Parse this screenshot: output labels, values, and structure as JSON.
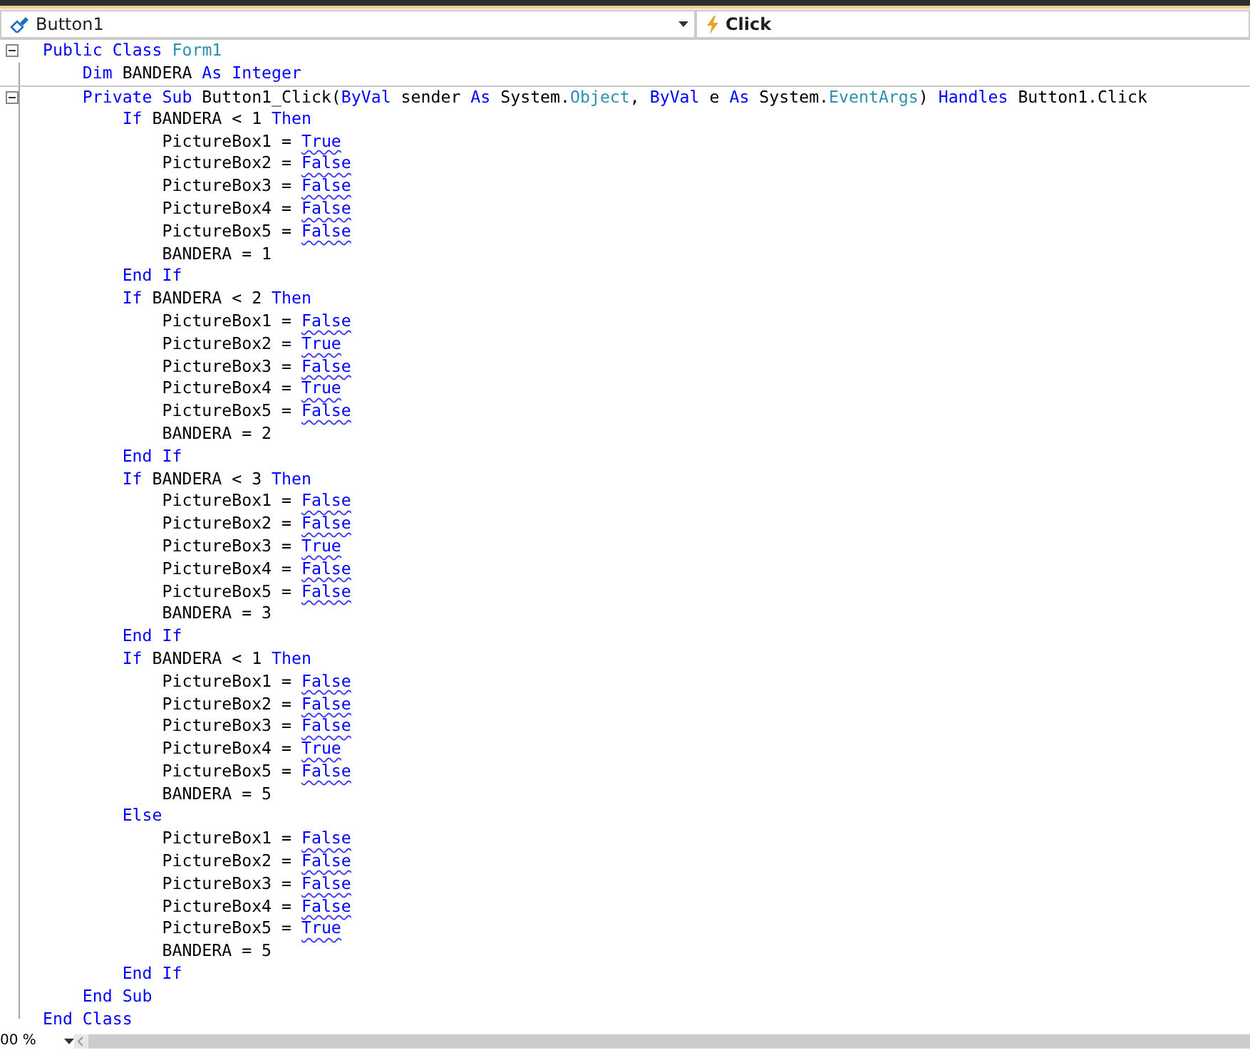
{
  "navigation_bar": {
    "object_dropdown": "Button1",
    "event_dropdown": "Click"
  },
  "code_lines": [
    {
      "expanded": true,
      "tokens": [
        {
          "text": "Public Class ",
          "kind": "kw"
        },
        {
          "text": "Form1",
          "kind": "type"
        }
      ],
      "children": [
        {
          "tokens": [
            {
              "text": "Dim ",
              "kind": "kw"
            },
            {
              "text": "BANDERA ",
              "kind": "plain"
            },
            {
              "text": "As Integer",
              "kind": "kw"
            }
          ]
        },
        {
          "expanded": true,
          "separator_above": true,
          "tokens": [
            {
              "text": "Private Sub ",
              "kind": "kw"
            },
            {
              "text": "Button1_Click(",
              "kind": "plain"
            },
            {
              "text": "ByVal ",
              "kind": "kw"
            },
            {
              "text": "sender ",
              "kind": "plain"
            },
            {
              "text": "As ",
              "kind": "kw"
            },
            {
              "text": "System.",
              "kind": "plain"
            },
            {
              "text": "Object",
              "kind": "type"
            },
            {
              "text": ", ",
              "kind": "plain"
            },
            {
              "text": "ByVal ",
              "kind": "kw"
            },
            {
              "text": "e ",
              "kind": "plain"
            },
            {
              "text": "As ",
              "kind": "kw"
            },
            {
              "text": "System.",
              "kind": "plain"
            },
            {
              "text": "EventArgs",
              "kind": "type"
            },
            {
              "text": ") ",
              "kind": "plain"
            },
            {
              "text": "Handles ",
              "kind": "kw"
            },
            {
              "text": "Button1.Click",
              "kind": "plain"
            }
          ],
          "children": [
            {
              "tokens": [
                {
                  "text": "If ",
                  "kind": "kw"
                },
                {
                  "text": "BANDERA < 1 ",
                  "kind": "plain"
                },
                {
                  "text": "Then",
                  "kind": "kw"
                }
              ],
              "children": [
                {
                  "tokens": [
                    {
                      "text": "PictureBox1 = ",
                      "kind": "plain"
                    },
                    {
                      "text": "True",
                      "kind": "warn"
                    }
                  ]
                },
                {
                  "tokens": [
                    {
                      "text": "PictureBox2 = ",
                      "kind": "plain"
                    },
                    {
                      "text": "False",
                      "kind": "warn"
                    }
                  ]
                },
                {
                  "tokens": [
                    {
                      "text": "PictureBox3 = ",
                      "kind": "plain"
                    },
                    {
                      "text": "False",
                      "kind": "warn"
                    }
                  ]
                },
                {
                  "tokens": [
                    {
                      "text": "PictureBox4 = ",
                      "kind": "plain"
                    },
                    {
                      "text": "False",
                      "kind": "warn"
                    }
                  ]
                },
                {
                  "tokens": [
                    {
                      "text": "PictureBox5 = ",
                      "kind": "plain"
                    },
                    {
                      "text": "False",
                      "kind": "warn"
                    }
                  ]
                },
                {
                  "tokens": [
                    {
                      "text": "BANDERA = 1",
                      "kind": "plain"
                    }
                  ]
                }
              ]
            },
            {
              "tokens": [
                {
                  "text": "End If",
                  "kind": "kw"
                }
              ]
            },
            {
              "tokens": [
                {
                  "text": "If ",
                  "kind": "kw"
                },
                {
                  "text": "BANDERA < 2 ",
                  "kind": "plain"
                },
                {
                  "text": "Then",
                  "kind": "kw"
                }
              ],
              "children": [
                {
                  "tokens": [
                    {
                      "text": "PictureBox1 = ",
                      "kind": "plain"
                    },
                    {
                      "text": "False",
                      "kind": "warn"
                    }
                  ]
                },
                {
                  "tokens": [
                    {
                      "text": "PictureBox2 = ",
                      "kind": "plain"
                    },
                    {
                      "text": "True",
                      "kind": "warn"
                    }
                  ]
                },
                {
                  "tokens": [
                    {
                      "text": "PictureBox3 = ",
                      "kind": "plain"
                    },
                    {
                      "text": "False",
                      "kind": "warn"
                    }
                  ]
                },
                {
                  "tokens": [
                    {
                      "text": "PictureBox4 = ",
                      "kind": "plain"
                    },
                    {
                      "text": "True",
                      "kind": "warn"
                    }
                  ]
                },
                {
                  "tokens": [
                    {
                      "text": "PictureBox5 = ",
                      "kind": "plain"
                    },
                    {
                      "text": "False",
                      "kind": "warn"
                    }
                  ]
                },
                {
                  "tokens": [
                    {
                      "text": "BANDERA = 2",
                      "kind": "plain"
                    }
                  ]
                }
              ]
            },
            {
              "tokens": [
                {
                  "text": "End If",
                  "kind": "kw"
                }
              ]
            },
            {
              "tokens": [
                {
                  "text": "If ",
                  "kind": "kw"
                },
                {
                  "text": "BANDERA < 3 ",
                  "kind": "plain"
                },
                {
                  "text": "Then",
                  "kind": "kw"
                }
              ],
              "children": [
                {
                  "tokens": [
                    {
                      "text": "PictureBox1 = ",
                      "kind": "plain"
                    },
                    {
                      "text": "False",
                      "kind": "warn"
                    }
                  ]
                },
                {
                  "tokens": [
                    {
                      "text": "PictureBox2 = ",
                      "kind": "plain"
                    },
                    {
                      "text": "False",
                      "kind": "warn"
                    }
                  ]
                },
                {
                  "tokens": [
                    {
                      "text": "PictureBox3 = ",
                      "kind": "plain"
                    },
                    {
                      "text": "True",
                      "kind": "warn"
                    }
                  ]
                },
                {
                  "tokens": [
                    {
                      "text": "PictureBox4 = ",
                      "kind": "plain"
                    },
                    {
                      "text": "False",
                      "kind": "warn"
                    }
                  ]
                },
                {
                  "tokens": [
                    {
                      "text": "PictureBox5 = ",
                      "kind": "plain"
                    },
                    {
                      "text": "False",
                      "kind": "warn"
                    }
                  ]
                },
                {
                  "tokens": [
                    {
                      "text": "BANDERA = 3",
                      "kind": "plain"
                    }
                  ]
                }
              ]
            },
            {
              "tokens": [
                {
                  "text": "End If",
                  "kind": "kw"
                }
              ]
            },
            {
              "tokens": [
                {
                  "text": "If ",
                  "kind": "kw"
                },
                {
                  "text": "BANDERA < 1 ",
                  "kind": "plain"
                },
                {
                  "text": "Then",
                  "kind": "kw"
                }
              ],
              "children": [
                {
                  "tokens": [
                    {
                      "text": "PictureBox1 = ",
                      "kind": "plain"
                    },
                    {
                      "text": "False",
                      "kind": "warn"
                    }
                  ]
                },
                {
                  "tokens": [
                    {
                      "text": "PictureBox2 = ",
                      "kind": "plain"
                    },
                    {
                      "text": "False",
                      "kind": "warn"
                    }
                  ]
                },
                {
                  "tokens": [
                    {
                      "text": "PictureBox3 = ",
                      "kind": "plain"
                    },
                    {
                      "text": "False",
                      "kind": "warn"
                    }
                  ]
                },
                {
                  "tokens": [
                    {
                      "text": "PictureBox4 = ",
                      "kind": "plain"
                    },
                    {
                      "text": "True",
                      "kind": "warn"
                    }
                  ]
                },
                {
                  "tokens": [
                    {
                      "text": "PictureBox5 = ",
                      "kind": "plain"
                    },
                    {
                      "text": "False",
                      "kind": "warn"
                    }
                  ]
                },
                {
                  "tokens": [
                    {
                      "text": "BANDERA = 5",
                      "kind": "plain"
                    }
                  ]
                }
              ]
            },
            {
              "tokens": [
                {
                  "text": "Else",
                  "kind": "kw"
                }
              ],
              "children": [
                {
                  "tokens": [
                    {
                      "text": "PictureBox1 = ",
                      "kind": "plain"
                    },
                    {
                      "text": "False",
                      "kind": "warn"
                    }
                  ]
                },
                {
                  "tokens": [
                    {
                      "text": "PictureBox2 = ",
                      "kind": "plain"
                    },
                    {
                      "text": "False",
                      "kind": "warn"
                    }
                  ]
                },
                {
                  "tokens": [
                    {
                      "text": "PictureBox3 = ",
                      "kind": "plain"
                    },
                    {
                      "text": "False",
                      "kind": "warn"
                    }
                  ]
                },
                {
                  "tokens": [
                    {
                      "text": "PictureBox4 = ",
                      "kind": "plain"
                    },
                    {
                      "text": "False",
                      "kind": "warn"
                    }
                  ]
                },
                {
                  "tokens": [
                    {
                      "text": "PictureBox5 = ",
                      "kind": "plain"
                    },
                    {
                      "text": "True",
                      "kind": "warn"
                    }
                  ]
                },
                {
                  "tokens": [
                    {
                      "text": "BANDERA = 5",
                      "kind": "plain"
                    }
                  ]
                }
              ]
            },
            {
              "tokens": [
                {
                  "text": "End If",
                  "kind": "kw"
                }
              ]
            }
          ]
        },
        {
          "tokens": [
            {
              "text": "End Sub",
              "kind": "kw"
            }
          ]
        }
      ]
    },
    {
      "tokens": [
        {
          "text": "End Class",
          "kind": "kw"
        }
      ]
    }
  ],
  "status": {
    "zoom": "00 %"
  }
}
